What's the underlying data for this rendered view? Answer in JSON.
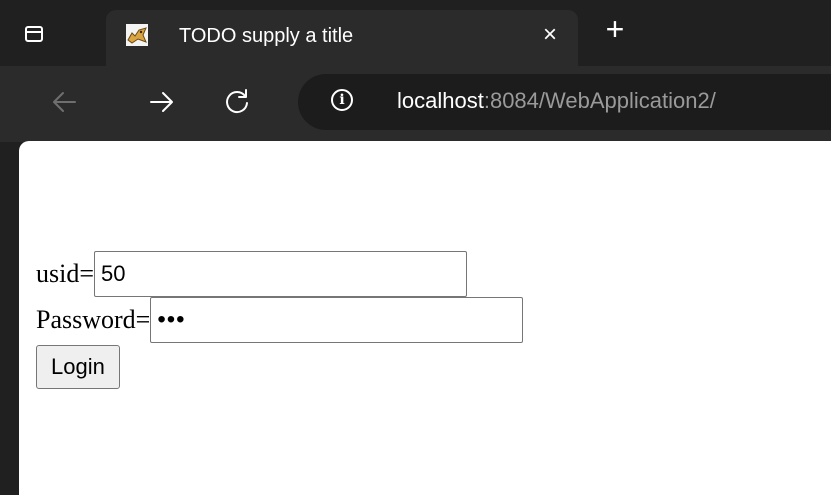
{
  "browser": {
    "tab": {
      "title": "TODO supply a title",
      "close_glyph": "×"
    },
    "new_tab_glyph": "+",
    "address": {
      "host": "localhost",
      "rest": ":8084/WebApplication2/",
      "info_glyph": "i"
    },
    "icons": {
      "sidebar": "sidebar-toggle-icon",
      "favicon": "tomcat-icon",
      "back": "arrow-left-icon",
      "forward": "arrow-right-icon",
      "reload": "reload-icon",
      "info": "info-icon"
    }
  },
  "form": {
    "usid_label": "usid=",
    "usid_value": "50",
    "password_label": "Password=",
    "password_value": "•••",
    "login_label": "Login"
  },
  "colors": {
    "chrome_dark": "#202020",
    "toolbar": "#2b2b2b",
    "page_bg": "#ffffff"
  }
}
